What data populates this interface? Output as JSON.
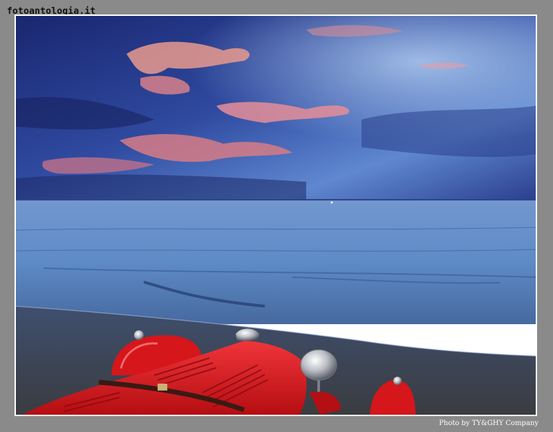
{
  "watermark": {
    "text": "fotoantologia.it"
  },
  "photo": {
    "subject": "red vintage car hood on a beach at dusk, sea and stormy sky",
    "colors": {
      "sky_top": "#1d2c7a",
      "sky_mid": "#3e5cb4",
      "sky_light": "#7fa6de",
      "cloud_pink": "#e9949a",
      "sea": "#5f8cc4",
      "sea_dark": "#3c5f9e",
      "sand": "#4a4d54",
      "car_red": "#d5161b"
    }
  },
  "credit": {
    "text": "Photo by TY&GHY Company"
  }
}
